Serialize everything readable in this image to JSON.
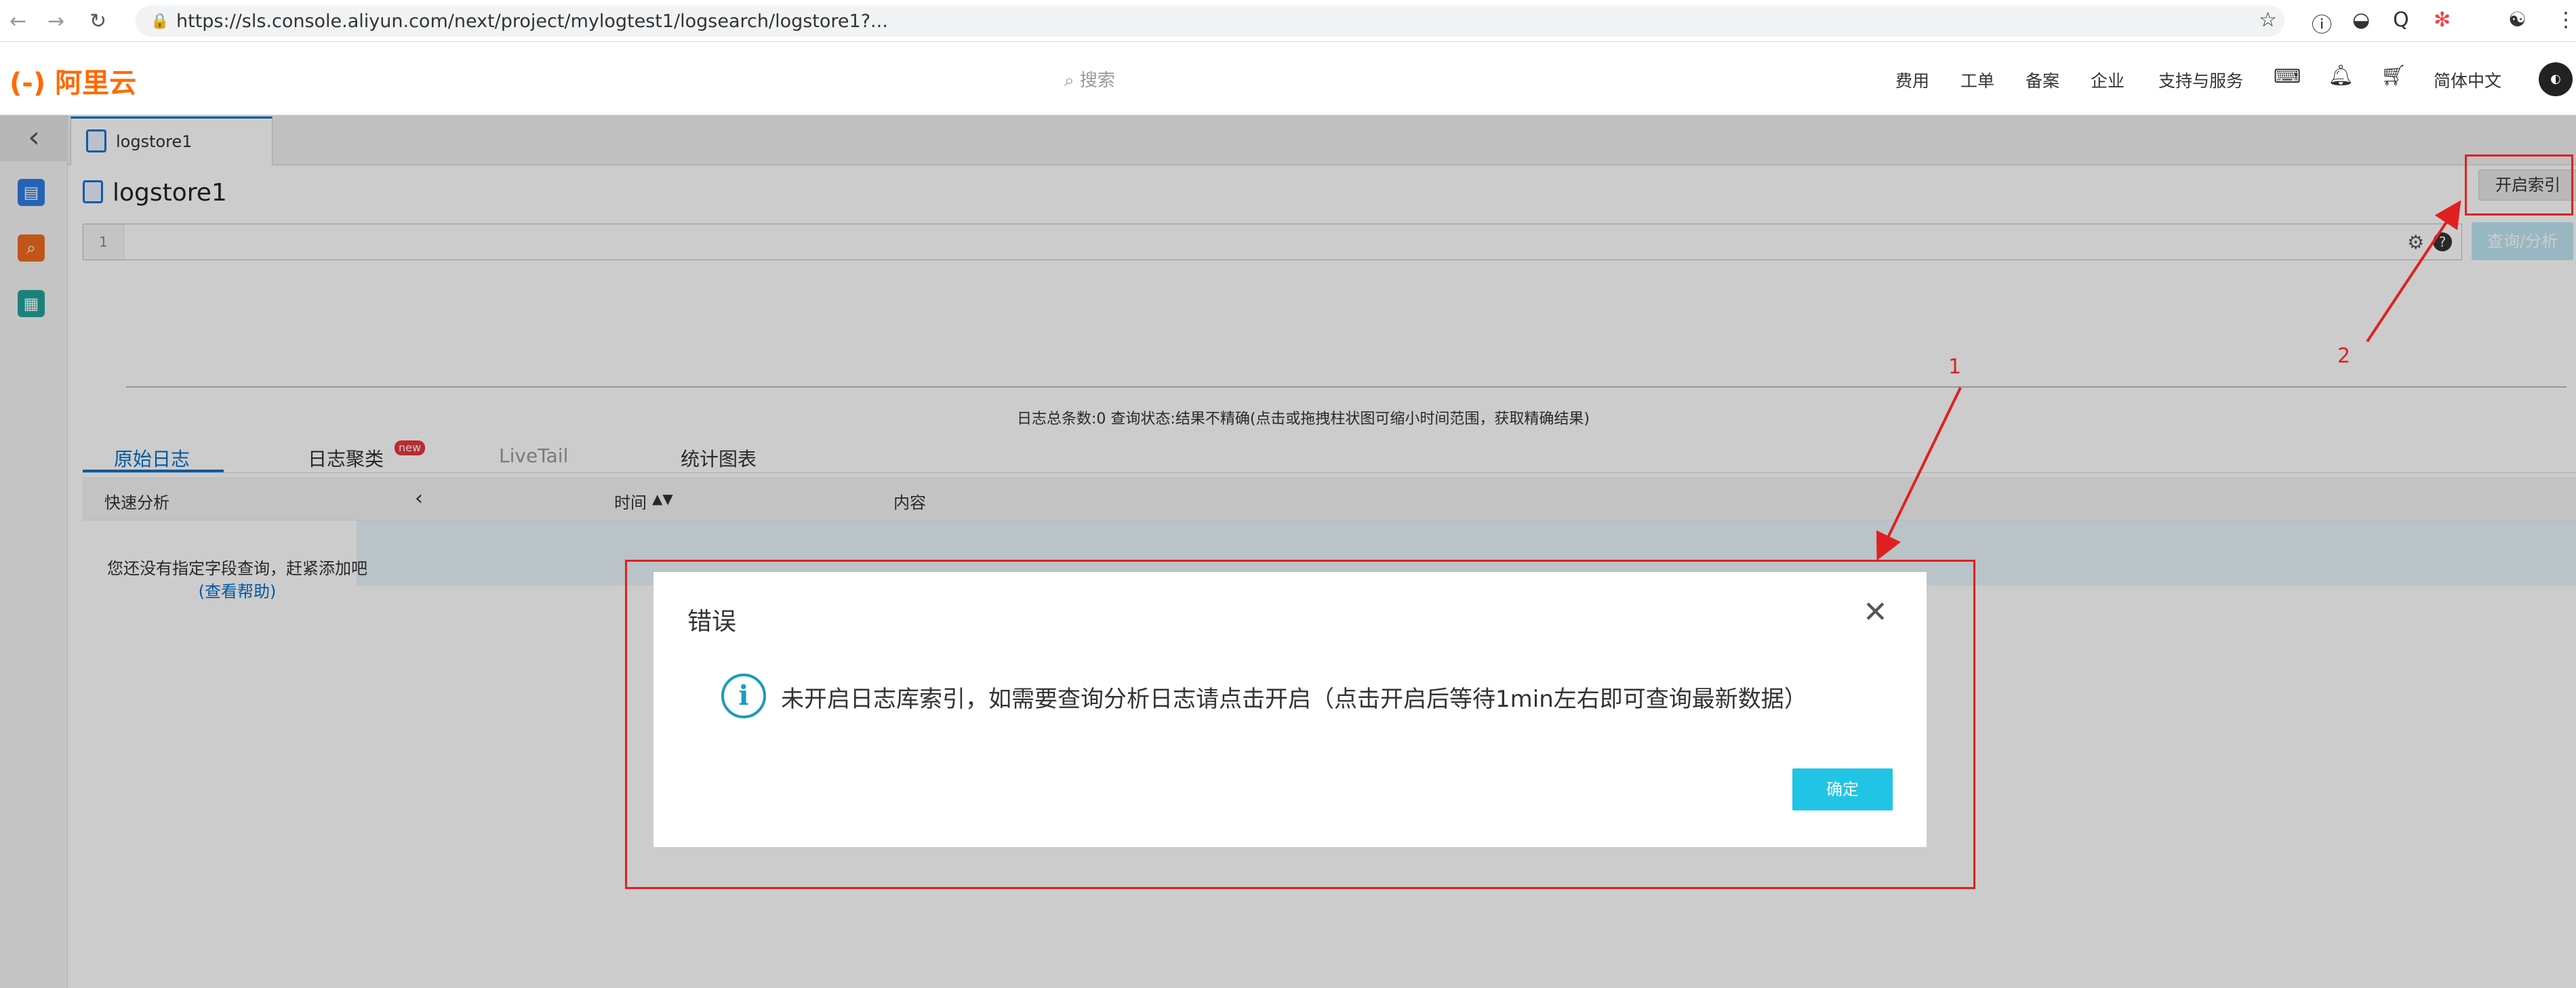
{
  "browser": {
    "url": "https://sls.console.aliyun.com/next/project/mylogtest1/logsearch/logstore1?..."
  },
  "header": {
    "logo": "(-) 阿里云",
    "search_placeholder": "搜索",
    "menu": [
      "费用",
      "工单",
      "备案",
      "企业",
      "支持与服务"
    ],
    "language": "简体中文"
  },
  "tab": {
    "label": "logstore1"
  },
  "main": {
    "title": "logstore1",
    "enable_index_button": "开启索引",
    "query_button": "查询/分析",
    "editor_line": "1",
    "status_text": "日志总条数:0  查询状态:结果不精确(点击或拖拽柱状图可缩小时间范围，获取精确结果)",
    "log_tabs": [
      "原始日志",
      "日志聚类",
      "LiveTail",
      "统计图表"
    ],
    "new_badge": "new",
    "columns": [
      "快速分析",
      "时间",
      "内容"
    ],
    "hint_text": "您还没有指定字段查询，赶紧添加吧",
    "hint_link": "(查看帮助)"
  },
  "dialog": {
    "title": "错误",
    "message": "未开启日志库索引，如需要查询分析日志请点击开启（点击开启后等待1min左右即可查询最新数据）",
    "ok_button": "确定"
  },
  "annotations": [
    "1",
    "2"
  ],
  "colors": {
    "brand": "#ff6a00",
    "primary": "#0070cc",
    "annotation": "#e02020",
    "ok_button": "#22c4e5"
  }
}
